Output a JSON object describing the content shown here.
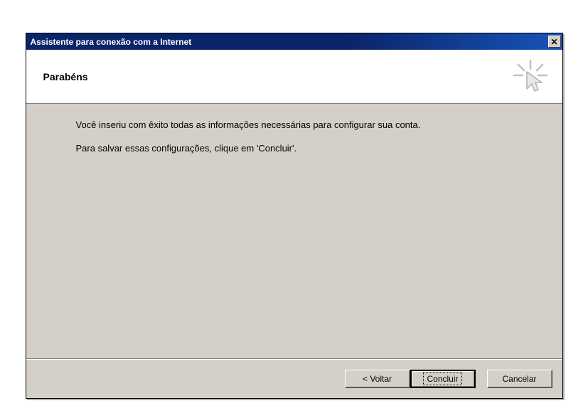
{
  "window": {
    "title": "Assistente para conexão com a Internet"
  },
  "header": {
    "title": "Parabéns"
  },
  "content": {
    "line1": "Você inseriu com êxito todas as informações necessárias para configurar sua conta.",
    "line2": "Para salvar essas configurações, clique em 'Concluir'."
  },
  "buttons": {
    "back": "< Voltar",
    "finish": "Concluir",
    "cancel": "Cancelar"
  }
}
